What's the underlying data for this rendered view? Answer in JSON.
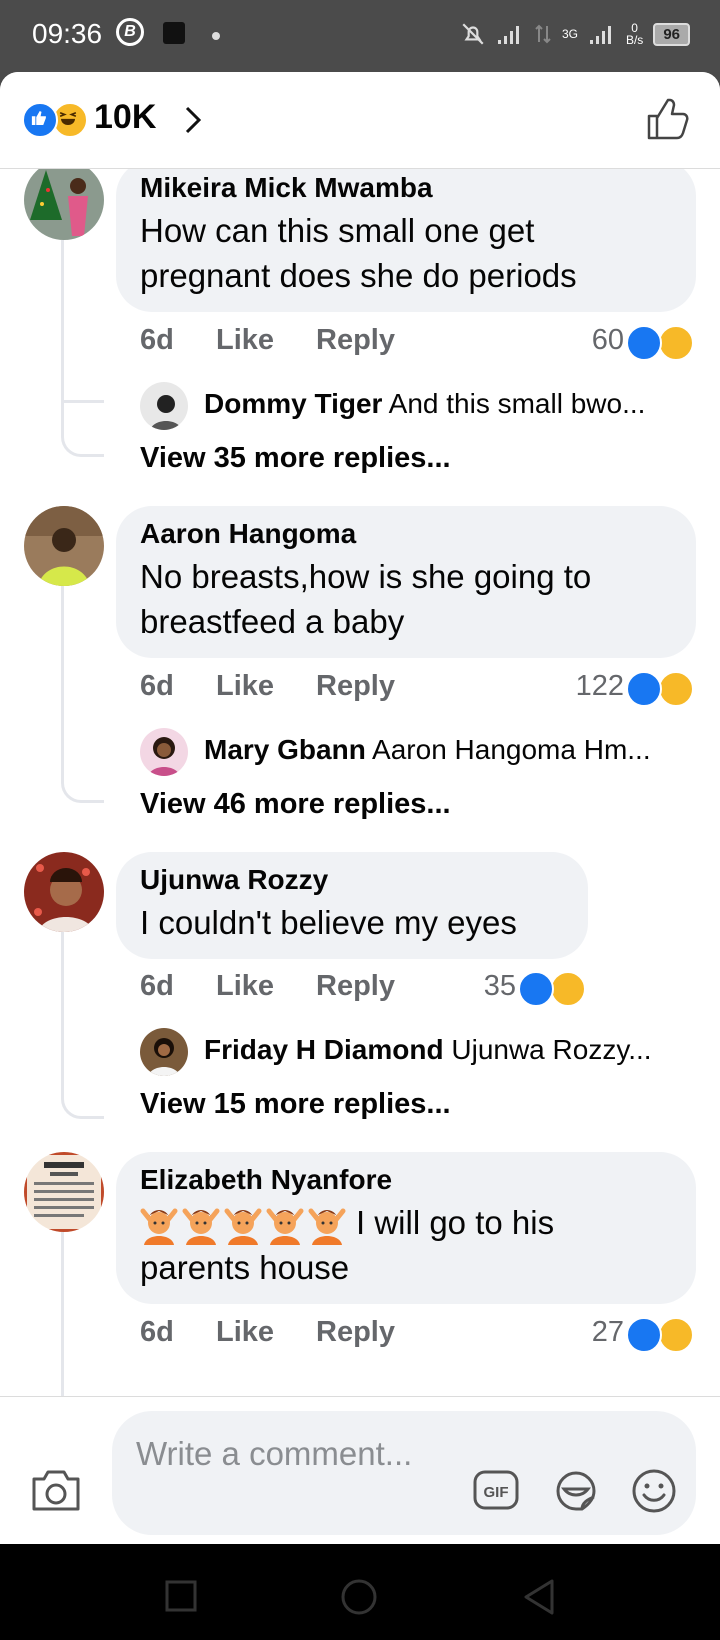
{
  "status_bar": {
    "time": "09:36",
    "net_type": "3G",
    "net_speed": "0",
    "net_unit": "B/s",
    "battery": "96"
  },
  "header": {
    "reaction_count": "10K",
    "reactions": [
      "like-icon",
      "haha-icon"
    ]
  },
  "comments": [
    {
      "author": "Mikeira Mick Mwamba",
      "text": "How can this small one get pregnant does she do periods",
      "time": "6d",
      "like_label": "Like",
      "reply_label": "Reply",
      "reaction_count": "60",
      "reply_preview": {
        "author": "Dommy Tiger",
        "text": "And this small bwo..."
      },
      "view_more": "View 35 more replies..."
    },
    {
      "author": "Aaron Hangoma",
      "text": "No breasts,how is she going to breastfeed a baby",
      "time": "6d",
      "like_label": "Like",
      "reply_label": "Reply",
      "reaction_count": "122",
      "reply_preview": {
        "author": "Mary Gbann",
        "text": "Aaron Hangoma Hm..."
      },
      "view_more": "View 46 more replies..."
    },
    {
      "author": "Ujunwa Rozzy",
      "text": "I couldn't believe my eyes",
      "time": "6d",
      "like_label": "Like",
      "reply_label": "Reply",
      "reaction_count": "35",
      "reply_preview": {
        "author": "Friday H Diamond",
        "text": "Ujunwa Rozzy..."
      },
      "view_more": "View 15 more replies..."
    },
    {
      "author": "Elizabeth Nyanfore",
      "text": "I will go to his parents house",
      "emoji": "person-gesturing-icon",
      "time": "6d",
      "like_label": "Like",
      "reply_label": "Reply",
      "reaction_count": "27"
    }
  ],
  "composer": {
    "placeholder": "Write a comment...",
    "gif_label": "GIF"
  },
  "colors": {
    "like_blue": "#1877f2",
    "haha_yellow": "#f7b928",
    "bubble_bg": "#f0f2f5",
    "secondary_text": "#65676b"
  }
}
